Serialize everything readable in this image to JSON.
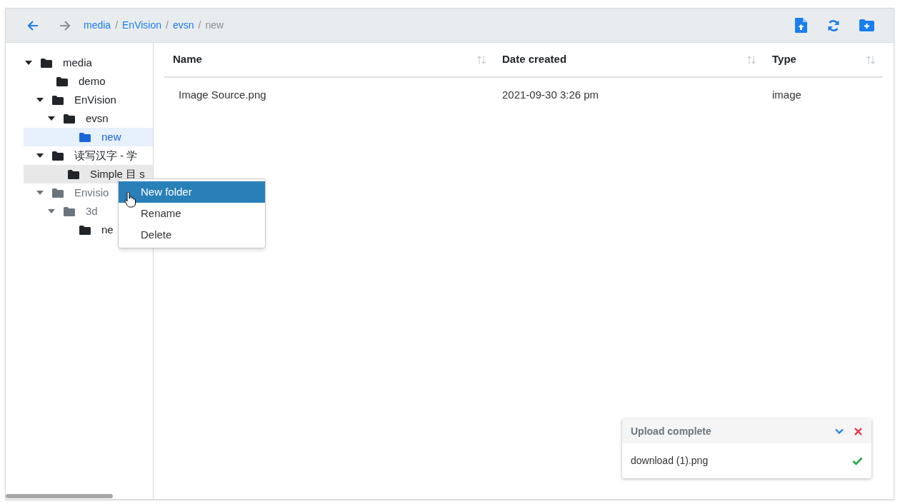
{
  "toolbar": {
    "separator": "/",
    "breadcrumbs": [
      {
        "label": "media",
        "current": false
      },
      {
        "label": "EnVision",
        "current": false
      },
      {
        "label": "evsn",
        "current": false
      },
      {
        "label": "new",
        "current": true
      }
    ],
    "back_disabled": false,
    "forward_disabled": true
  },
  "tree": [
    {
      "label": "media",
      "expanded": true,
      "selected": false,
      "highlighted": false,
      "dimmed": false,
      "children": [
        {
          "label": "demo",
          "selected": false,
          "highlighted": false,
          "dimmed": false
        },
        {
          "label": "EnVision",
          "expanded": true,
          "selected": false,
          "highlighted": false,
          "dimmed": false,
          "children": [
            {
              "label": "evsn",
              "expanded": true,
              "selected": false,
              "highlighted": false,
              "dimmed": false,
              "children": [
                {
                  "label": "new",
                  "selected": true,
                  "highlighted": false,
                  "dimmed": false
                }
              ]
            }
          ]
        },
        {
          "label": "读写汉字 - 学",
          "expanded": true,
          "selected": false,
          "highlighted": false,
          "dimmed": false,
          "children": [
            {
              "label": "Simple 目 s",
              "selected": false,
              "highlighted": true,
              "dimmed": false
            }
          ]
        },
        {
          "label": "Envisio",
          "expanded": true,
          "selected": false,
          "highlighted": false,
          "dimmed": true,
          "children": [
            {
              "label": "3d",
              "expanded": true,
              "selected": false,
              "highlighted": false,
              "dimmed": true,
              "children": [
                {
                  "label": "ne",
                  "selected": false,
                  "highlighted": false,
                  "dimmed": false
                }
              ]
            }
          ]
        }
      ]
    }
  ],
  "table": {
    "columns": [
      "Name",
      "Date created",
      "Type"
    ],
    "rows": [
      [
        "Image Source.png",
        "2021-09-30 3:26 pm",
        "image"
      ]
    ]
  },
  "context_menu": {
    "items": [
      {
        "label": "New folder",
        "selected": true
      },
      {
        "label": "Rename",
        "selected": false
      },
      {
        "label": "Delete",
        "selected": false
      }
    ]
  },
  "upload_panel": {
    "title": "Upload complete",
    "files": [
      {
        "name": "download (1).png",
        "done": true
      }
    ]
  }
}
